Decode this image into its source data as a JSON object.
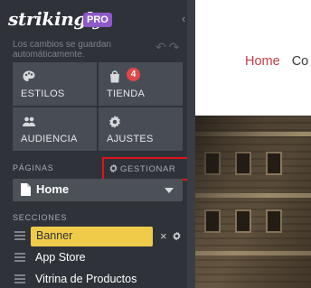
{
  "sidebar": {
    "logo": "strikingly",
    "pro_badge": "PRO",
    "saved_status": "Los cambios se guardan automáticamente.",
    "tiles": [
      {
        "label": "ESTILOS",
        "icon": "palette-icon"
      },
      {
        "label": "TIENDA",
        "icon": "shopping-bag-icon",
        "badge": "4"
      },
      {
        "label": "AUDIENCIA",
        "icon": "users-icon"
      },
      {
        "label": "AJUSTES",
        "icon": "gear-icon"
      }
    ],
    "pages_label": "PÁGINAS",
    "manage_label": "GESTIONAR",
    "current_page": "Home",
    "sections_label": "SECCIONES",
    "sections": [
      "Banner",
      "App Store",
      "Vitrina de Productos"
    ]
  },
  "preview": {
    "nav": [
      "Home",
      "Co"
    ]
  },
  "colors": {
    "sidebar_bg": "#2f3339",
    "tile_bg": "#484d55",
    "pro_purple": "#8e59c9",
    "badge_red": "#e34747",
    "highlight_red": "#e0141b",
    "banner_yellow": "#f0cb4a",
    "nav_red": "#c53b48"
  }
}
